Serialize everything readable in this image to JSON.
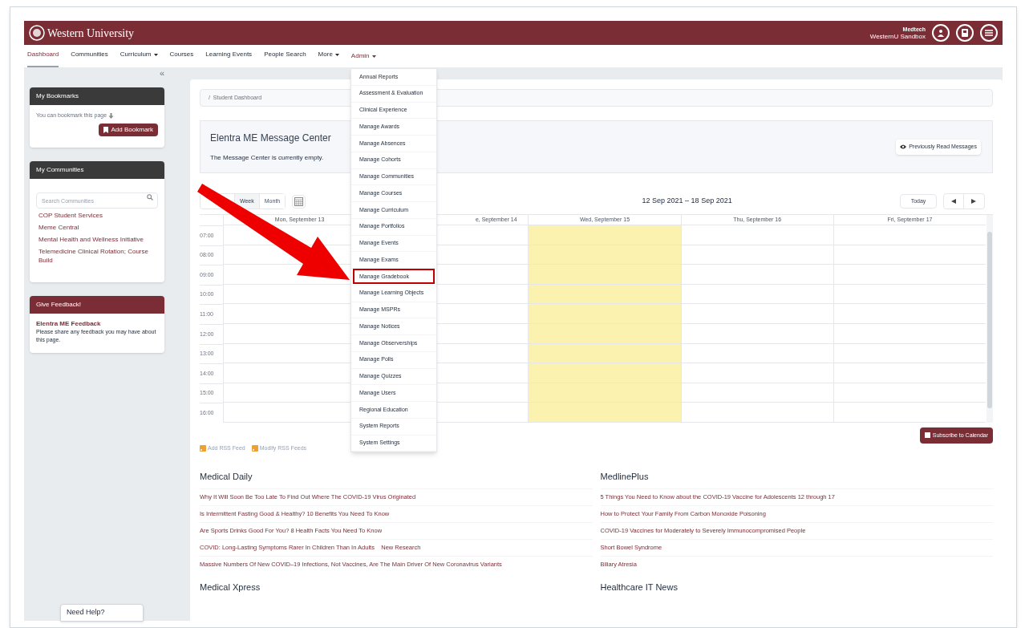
{
  "header": {
    "logo": "Western University",
    "user_name": "Medtech",
    "organisation": "WesternU Sandbox"
  },
  "nav": [
    {
      "label": "Dashboard",
      "selected": true,
      "caret": false
    },
    {
      "label": "Communities",
      "selected": false,
      "caret": false
    },
    {
      "label": "Curriculum",
      "selected": false,
      "caret": true
    },
    {
      "label": "Courses",
      "selected": false,
      "caret": false
    },
    {
      "label": "Learning Events",
      "selected": false,
      "caret": false
    },
    {
      "label": "People Search",
      "selected": false,
      "caret": false
    },
    {
      "label": "More",
      "selected": false,
      "caret": true
    },
    {
      "label": "Admin",
      "selected": false,
      "caret": true
    }
  ],
  "collapse_toggle": "«",
  "sidebar": {
    "bookmarks": {
      "title": "My Bookmarks",
      "hint": "You can bookmark this page",
      "button": "Add Bookmark"
    },
    "communities": {
      "title": "My Communities",
      "search_placeholder": "Search Communities",
      "items": [
        "COP Student Services",
        "Meme Central",
        "Mental Health and Wellness Initiative",
        "Telemedicine Clinical Rotation; Course Build"
      ]
    },
    "feedback": {
      "title": "Give Feedback!",
      "link": "Elentra ME Feedback",
      "text": "Please share any feedback you may have about this page."
    }
  },
  "breadcrumb": "/  Student Dashboard",
  "message_center": {
    "title": "Elentra ME Message Center",
    "text": "The Message Center is currently empty.",
    "button": "Previously Read Messages"
  },
  "calendar": {
    "views": [
      {
        "label": "Week",
        "selected": true
      },
      {
        "label": "Month",
        "selected": false
      }
    ],
    "range": "12 Sep 2021 – 18 Sep 2021",
    "today_button": "Today",
    "days": [
      {
        "label": "Mon, September 13",
        "today": false
      },
      {
        "label": "e, September 14",
        "today": false
      },
      {
        "label": "Wed, September 15",
        "today": true
      },
      {
        "label": "Thu, September 16",
        "today": false
      },
      {
        "label": "Fri, September 17",
        "today": false
      }
    ],
    "times": [
      "07:00",
      "08:00",
      "09:00",
      "10:00",
      "11:00",
      "12:00",
      "13:00",
      "14:00",
      "15:00",
      "16:00"
    ],
    "subscribe_button": "Subscribe to Calendar"
  },
  "rss": [
    "Add RSS Feed",
    "Modify RSS Feeds"
  ],
  "feeds": [
    {
      "title": "Medical Daily",
      "items": [
        "Why It Will Soon Be Too Late To Find Out Where The COVID-19 Virus Originated",
        "Is Intermittent Fasting Good & Healthy? 10 Benefits You Need To Know",
        "Are Sports Drinks Good For You? 8 Health Facts You Need To Know",
        "COVID: Long-Lasting Symptoms Rarer In Children Than In Adults    New Research",
        "Massive Numbers Of New COVID–19 Infections, Not Vaccines, Are The Main Driver Of New Coronavirus Variants"
      ]
    },
    {
      "title": "MedlinePlus",
      "items": [
        "5 Things You Need to Know about the COVID-19 Vaccine for Adolescents 12 through 17",
        "How to Protect Your Family From Carbon Monoxide Poisoning",
        "COVID-19 Vaccines for Moderately to Severely Immunocompromised People",
        "Short Bowel Syndrome",
        "Biliary Atresia"
      ]
    },
    {
      "title": "Medical Xpress"
    },
    {
      "title": "Healthcare IT News"
    }
  ],
  "admin_menu": [
    {
      "label": "Annual Reports",
      "highlighted": false
    },
    {
      "label": "Assessment & Evaluation",
      "highlighted": false
    },
    {
      "label": "Clinical Experience",
      "highlighted": false
    },
    {
      "label": "Manage Awards",
      "highlighted": false
    },
    {
      "label": "Manage Absences",
      "highlighted": false
    },
    {
      "label": "Manage Cohorts",
      "highlighted": false
    },
    {
      "label": "Manage Communities",
      "highlighted": false
    },
    {
      "label": "Manage Courses",
      "highlighted": false
    },
    {
      "label": "Manage Curriculum",
      "highlighted": false
    },
    {
      "label": "Manage Portfolios",
      "highlighted": false
    },
    {
      "label": "Manage Events",
      "highlighted": false
    },
    {
      "label": "Manage Exams",
      "highlighted": false
    },
    {
      "label": "Manage Gradebook",
      "highlighted": true
    },
    {
      "label": "Manage Learning Objects",
      "highlighted": false
    },
    {
      "label": "Manage MSPRs",
      "highlighted": false
    },
    {
      "label": "Manage Notices",
      "highlighted": false
    },
    {
      "label": "Manage Observerships",
      "highlighted": false
    },
    {
      "label": "Manage Polls",
      "highlighted": false
    },
    {
      "label": "Manage Quizzes",
      "highlighted": false
    },
    {
      "label": "Manage Users",
      "highlighted": false
    },
    {
      "label": "Regional Education",
      "highlighted": false
    },
    {
      "label": "System Reports",
      "highlighted": false
    },
    {
      "label": "System Settings",
      "highlighted": false
    }
  ],
  "help_tab": "Need Help?"
}
